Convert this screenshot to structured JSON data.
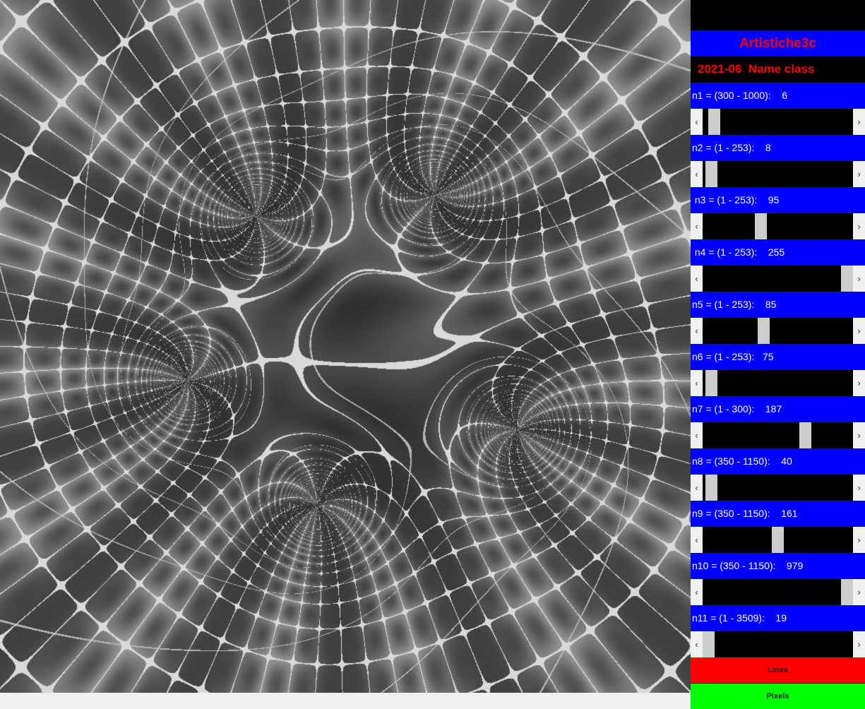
{
  "app": {
    "title": "Artistiche3c",
    "subtitle": "2021-06  Name class"
  },
  "colors": {
    "panel_blue": "#0000ff",
    "title_red": "#ff0000",
    "button_linea": "#ff0000",
    "button_pixels": "#00ff00",
    "scroll_thumb": "#cdcdcd"
  },
  "params": [
    {
      "label": "n1 = (300 - 1000):    6",
      "level": 0.04
    },
    {
      "label": "n2 = (1 - 253):    8",
      "level": 0.02
    },
    {
      "label": " n3 = (1 - 253):    95",
      "level": 0.38
    },
    {
      "label": " n4 = (1 - 253):    255",
      "level": 1.0
    },
    {
      "label": "n5 = (1 - 253):    85",
      "level": 0.4
    },
    {
      "label": "n6 = (1 - 253):   75",
      "level": 0.02
    },
    {
      "label": "n7 = (1 - 300):    187",
      "level": 0.7
    },
    {
      "label": "n8 = (350 - 1150):    40",
      "level": 0.02
    },
    {
      "label": "n9 = (350 - 1150):    161",
      "level": 0.5
    },
    {
      "label": "n10 = (350 - 1150):    979",
      "level": 1.0
    },
    {
      "label": "n11 = (1 - 3509):    19",
      "level": 0.0
    }
  ],
  "buttons": {
    "linea": "Linea",
    "pixels": "Pixels"
  },
  "icons": {
    "scroll_left": "chevron-left-icon",
    "scroll_right": "chevron-right-icon"
  }
}
